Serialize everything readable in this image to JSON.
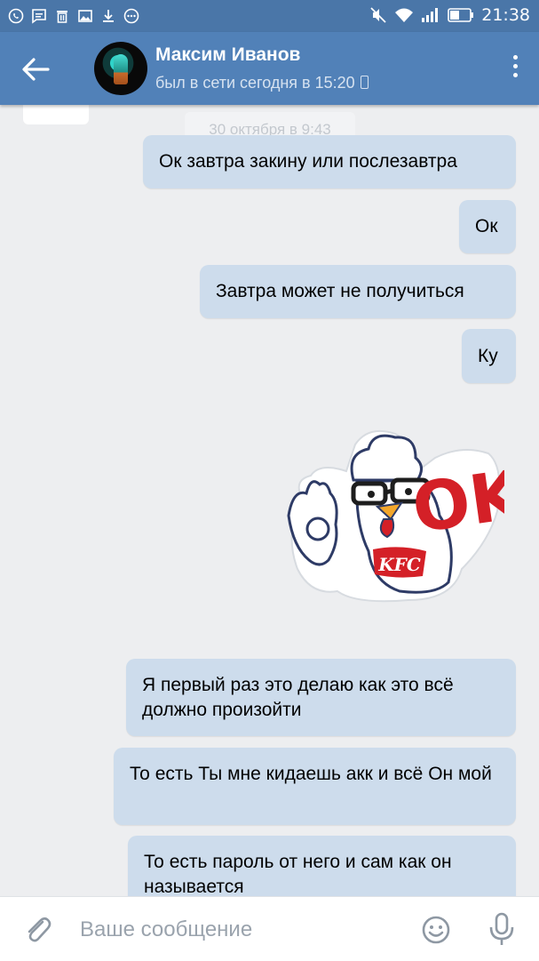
{
  "status_bar": {
    "time": "21:38",
    "left_icons": [
      "whatsapp-icon",
      "message-icon",
      "trash-icon",
      "image-icon",
      "download-icon",
      "more-circle-icon"
    ],
    "right_icons": [
      "mute-icon",
      "wifi-icon",
      "signal-icon",
      "battery-icon"
    ]
  },
  "header": {
    "contact_name": "Максим Иванов",
    "contact_status": "был в сети сегодня в 15:20",
    "back_icon": "arrow-left-icon",
    "menu_icon": "more-vertical-icon"
  },
  "conversation": {
    "date_divider": "30 октября в 9:43",
    "messages": [
      {
        "text": "Ок завтра закину или послезавтра",
        "outgoing": true
      },
      {
        "text": "Ок",
        "outgoing": true
      },
      {
        "text": "Завтра может не получиться",
        "outgoing": true
      },
      {
        "text": "Ку",
        "outgoing": true
      },
      {
        "sticker": "kfc-rooster-ok-sticker",
        "sticker_text": "OK",
        "sticker_brand": "KFC",
        "outgoing": true
      },
      {
        "text": "Я первый раз это делаю как это всё должно произойти",
        "outgoing": true
      },
      {
        "text": "То есть Ты мне кидаешь акк и всё Он мой",
        "outgoing": true
      },
      {
        "text": "То есть пароль от него и сам как он называется",
        "outgoing": true
      }
    ]
  },
  "composer": {
    "placeholder": "Ваше сообщение",
    "value": ""
  },
  "colors": {
    "header": "#5181b8",
    "status_bar": "#4a76a8",
    "outgoing_bubble": "#cddcec",
    "background": "#edeef0"
  }
}
